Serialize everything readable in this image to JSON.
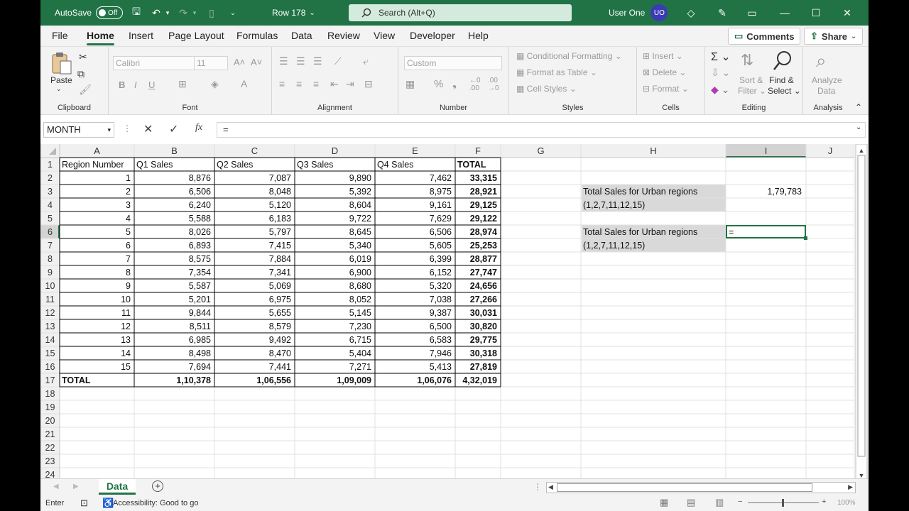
{
  "titlebar": {
    "autosave_label": "AutoSave",
    "autosave_state": "Off",
    "doc_title": "Row 178",
    "search_placeholder": "Search (Alt+Q)",
    "user_name": "User One",
    "user_initials": "UO"
  },
  "menu": [
    "File",
    "Home",
    "Insert",
    "Page Layout",
    "Formulas",
    "Data",
    "Review",
    "View",
    "Developer",
    "Help"
  ],
  "menu_active": "Home",
  "comments_label": "Comments",
  "share_label": "Share",
  "ribbon": {
    "clipboard": {
      "paste": "Paste",
      "label": "Clipboard"
    },
    "font": {
      "name": "Calibri",
      "size": "11",
      "label": "Font",
      "bold": "B",
      "italic": "I",
      "underline": "U"
    },
    "alignment": {
      "label": "Alignment"
    },
    "number": {
      "format": "Custom",
      "label": "Number"
    },
    "styles": {
      "cond": "Conditional Formatting",
      "table": "Format as Table",
      "cell": "Cell Styles",
      "label": "Styles"
    },
    "cells": {
      "insert": "Insert",
      "delete": "Delete",
      "format": "Format",
      "label": "Cells"
    },
    "editing": {
      "sort1": "Sort &",
      "sort2": "Filter",
      "find1": "Find &",
      "find2": "Select",
      "label": "Editing"
    },
    "analysis": {
      "a1": "Analyze",
      "a2": "Data",
      "label": "Analysis"
    }
  },
  "formula_bar": {
    "name_box": "MONTH",
    "formula": "="
  },
  "columns": [
    "A",
    "B",
    "C",
    "D",
    "E",
    "F",
    "G",
    "H",
    "I",
    "J"
  ],
  "rows": [
    "1",
    "2",
    "3",
    "4",
    "5",
    "6",
    "7",
    "8",
    "9",
    "10",
    "11",
    "12",
    "13",
    "14",
    "15",
    "16",
    "17",
    "18",
    "19",
    "20",
    "21",
    "22",
    "23",
    "24"
  ],
  "table": {
    "headers": [
      "Region Number",
      "Q1 Sales",
      "Q2 Sales",
      "Q3 Sales",
      "Q4 Sales",
      "TOTAL"
    ],
    "data": [
      [
        "1",
        "8,876",
        "7,087",
        "9,890",
        "7,462",
        "33,315"
      ],
      [
        "2",
        "6,506",
        "8,048",
        "5,392",
        "8,975",
        "28,921"
      ],
      [
        "3",
        "6,240",
        "5,120",
        "8,604",
        "9,161",
        "29,125"
      ],
      [
        "4",
        "5,588",
        "6,183",
        "9,722",
        "7,629",
        "29,122"
      ],
      [
        "5",
        "8,026",
        "5,797",
        "8,645",
        "6,506",
        "28,974"
      ],
      [
        "6",
        "6,893",
        "7,415",
        "5,340",
        "5,605",
        "25,253"
      ],
      [
        "7",
        "8,575",
        "7,884",
        "6,019",
        "6,399",
        "28,877"
      ],
      [
        "8",
        "7,354",
        "7,341",
        "6,900",
        "6,152",
        "27,747"
      ],
      [
        "9",
        "5,587",
        "5,069",
        "8,680",
        "5,320",
        "24,656"
      ],
      [
        "10",
        "5,201",
        "6,975",
        "8,052",
        "7,038",
        "27,266"
      ],
      [
        "11",
        "9,844",
        "5,655",
        "5,145",
        "9,387",
        "30,031"
      ],
      [
        "12",
        "8,511",
        "8,579",
        "7,230",
        "6,500",
        "30,820"
      ],
      [
        "13",
        "6,985",
        "9,492",
        "6,715",
        "6,583",
        "29,775"
      ],
      [
        "14",
        "8,498",
        "8,470",
        "5,404",
        "7,946",
        "30,318"
      ],
      [
        "15",
        "7,694",
        "7,441",
        "7,271",
        "5,413",
        "27,819"
      ]
    ],
    "total": [
      "TOTAL",
      "1,10,378",
      "1,06,556",
      "1,09,009",
      "1,06,076",
      "4,32,019"
    ]
  },
  "side": {
    "label1_line1": "Total Sales for Urban regions",
    "label1_line2": "(1,2,7,11,12,15)",
    "value1": "1,79,783",
    "label2_line1": "Total Sales for Urban regions",
    "label2_line2": "(1,2,7,11,12,15)",
    "value2": "="
  },
  "sheet_tab": "Data",
  "status": {
    "mode": "Enter",
    "accessibility": "Accessibility: Good to go",
    "zoom": "100%"
  }
}
